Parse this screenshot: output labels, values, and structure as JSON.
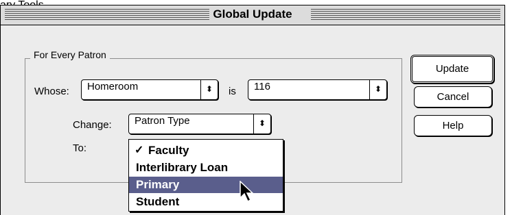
{
  "caption": "ary Tools",
  "window": {
    "title": "Global Update"
  },
  "group": {
    "label": "For Every Patron"
  },
  "whose": {
    "label": "Whose:",
    "field_value": "Homeroom",
    "is_label": "is",
    "is_value": "116",
    "arrow_icon": "up-down-arrows"
  },
  "change": {
    "label": "Change:",
    "value": "Patron Type"
  },
  "to": {
    "label": "To:"
  },
  "menu": {
    "items": [
      {
        "label": "Faculty",
        "checked": true,
        "selected": false
      },
      {
        "label": "Interlibrary Loan",
        "checked": false,
        "selected": false
      },
      {
        "label": "Primary",
        "checked": false,
        "selected": true
      },
      {
        "label": "Student",
        "checked": false,
        "selected": false
      }
    ],
    "check_glyph": "✓",
    "highlight_color": "#5a5e8c"
  },
  "buttons": {
    "update": "Update",
    "cancel": "Cancel",
    "help": "Help"
  }
}
